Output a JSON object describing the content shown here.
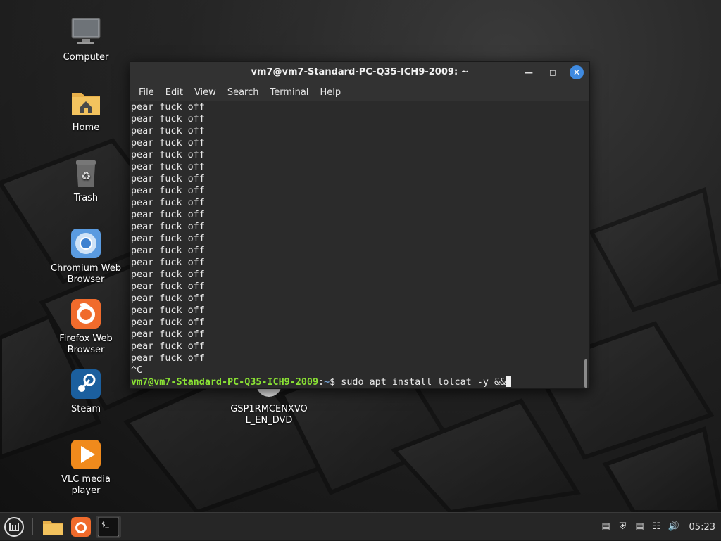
{
  "desktop": {
    "icons": [
      {
        "label": "Computer",
        "icon": "computer-icon"
      },
      {
        "label": "Home",
        "icon": "home-folder-icon"
      },
      {
        "label": "Trash",
        "icon": "trash-icon"
      },
      {
        "label": "Chromium Web Browser",
        "icon": "chromium-icon"
      },
      {
        "label": "Firefox Web Browser",
        "icon": "firefox-icon"
      },
      {
        "label": "Steam",
        "icon": "steam-icon"
      },
      {
        "label": "VLC media player",
        "icon": "vlc-icon"
      }
    ],
    "dvd": {
      "label_line1": "GSP1RMCENXVO",
      "label_line2": "L_EN_DVD",
      "icon": "dvd-icon"
    }
  },
  "terminal": {
    "title": "vm7@vm7-Standard-PC-Q35-ICH9-2009: ~",
    "menu": [
      "File",
      "Edit",
      "View",
      "Search",
      "Terminal",
      "Help"
    ],
    "output_line": "pear fuck off",
    "output_repeat": 22,
    "interrupt": "^C",
    "prompt_user": "vm7@vm7-Standard-PC-Q35-ICH9-2009",
    "prompt_sep": ":",
    "prompt_path": "~",
    "prompt_symbol": "$ ",
    "command": "sudo apt install lolcat -y &&"
  },
  "taskbar": {
    "clock": "05:23",
    "apps": [
      "menu-icon",
      "files-icon",
      "firefox-icon",
      "terminal-icon"
    ],
    "tray": [
      "clipboard-icon",
      "shield-icon",
      "notes-icon",
      "network-icon",
      "volume-icon"
    ]
  },
  "colors": {
    "prompt_user": "#8ae234",
    "prompt_path": "#729fcf",
    "close_button": "#3f8ae0"
  }
}
